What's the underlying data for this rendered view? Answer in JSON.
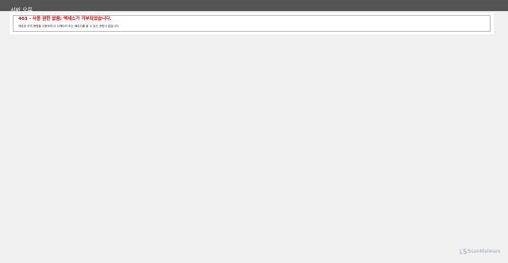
{
  "header": {
    "title": "서버 오류"
  },
  "error": {
    "title": "403 - 사용 권한 없음: 액세스가 거부되었습니다.",
    "description": "제공한 자격 증명을 사용하여 이 디렉터리 또는 페이지를 볼 수 있는 권한이 없습니다."
  },
  "watermark": {
    "text": "ScanMalware",
    "icon": "scanmalware-logo-icon"
  },
  "colors": {
    "header_bg": "#555555",
    "page_bg": "#f0f0f0",
    "error_title": "#cc0000",
    "watermark": "#a9bfd4"
  }
}
